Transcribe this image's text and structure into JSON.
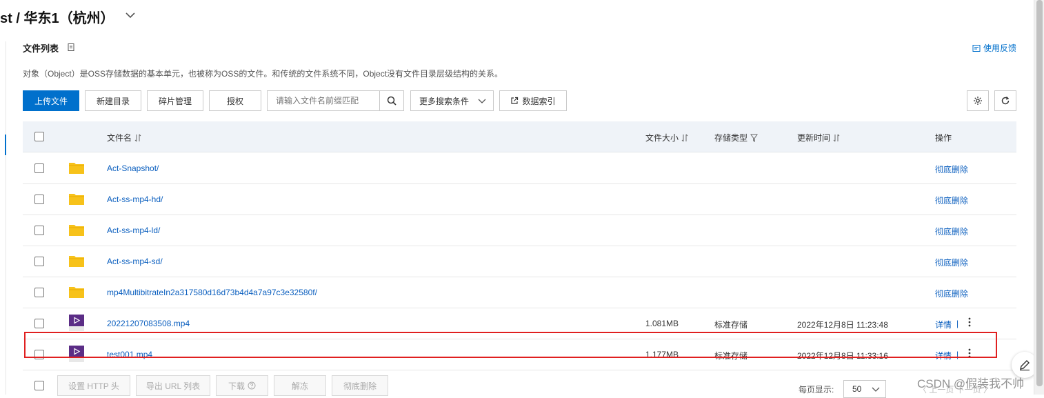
{
  "header": {
    "bucket_title": "st / 华东1（杭州）",
    "section_title": "文件列表",
    "feedback_label": "使用反馈",
    "description": "对象（Object）是OSS存储数据的基本单元，也被称为OSS的文件。和传统的文件系统不同，Object没有文件目录层级结构的关系。"
  },
  "toolbar": {
    "upload_label": "上传文件",
    "new_dir_label": "新建目录",
    "fragments_label": "碎片管理",
    "authorize_label": "授权",
    "search_placeholder": "请输入文件名前缀匹配",
    "more_search_label": "更多搜索条件",
    "data_index_label": "数据索引"
  },
  "table": {
    "columns": {
      "name": "文件名",
      "size": "文件大小",
      "storage_class": "存储类型",
      "updated": "更新时间",
      "actions": "操作"
    },
    "rows": [
      {
        "type": "folder",
        "name": "Act-Snapshot/",
        "size": "",
        "storage": "",
        "updated": "",
        "action": "彻底删除"
      },
      {
        "type": "folder",
        "name": "Act-ss-mp4-hd/",
        "size": "",
        "storage": "",
        "updated": "",
        "action": "彻底删除"
      },
      {
        "type": "folder",
        "name": "Act-ss-mp4-ld/",
        "size": "",
        "storage": "",
        "updated": "",
        "action": "彻底删除"
      },
      {
        "type": "folder",
        "name": "Act-ss-mp4-sd/",
        "size": "",
        "storage": "",
        "updated": "",
        "action": "彻底删除"
      },
      {
        "type": "folder",
        "name": "mp4MultibitrateIn2a317580d16d73b4d4a7a97c3e32580f/",
        "size": "",
        "storage": "",
        "updated": "",
        "action": "彻底删除"
      },
      {
        "type": "video",
        "name": "20221207083508.mp4",
        "size": "1.081MB",
        "storage": "标准存储",
        "updated": "2022年12月8日 11:23:48",
        "action": "详情",
        "separator": "|"
      },
      {
        "type": "video",
        "name": "test001.mp4",
        "size": "1.177MB",
        "storage": "标准存储",
        "updated": "2022年12月8日 11:33:16",
        "action": "详情",
        "separator": "|"
      }
    ]
  },
  "bottom": {
    "set_http_header_label": "设置 HTTP 头",
    "export_url_label": "导出 URL 列表",
    "download_label": "下载",
    "unfreeze_label": "解冻",
    "delete_label": "彻底删除",
    "page_size_label": "每页显示:",
    "page_size_value": "50",
    "pager_text": "〈 上一页    下一页 〉"
  },
  "watermark": "CSDN @假装我不帅",
  "colors": {
    "primary": "#0070cc",
    "link": "#0b5fbf",
    "folder": "#f7c21a",
    "video": "#5b2d86",
    "highlight": "#e02020",
    "header_bg": "#eff3f8"
  }
}
